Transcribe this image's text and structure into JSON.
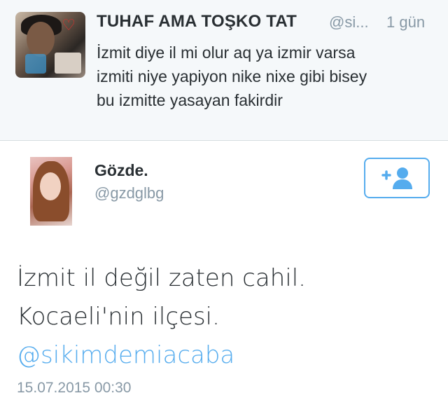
{
  "top_tweet": {
    "name": "TUHAF AMA TOŞKO TAT",
    "handle": "@si...",
    "time": "1 gün",
    "lines": [
      "İzmit diye il mi olur aq ya izmir varsa",
      "izmiti niye yapiyon nike nixe gibi bisey",
      "bu izmitte yasayan fakirdir"
    ]
  },
  "main_tweet": {
    "name": "Gözde.",
    "handle": "@gzdglbg",
    "lines": [
      "İzmit il değil zaten cahil.",
      "Kocaeli'nin ilçesi."
    ],
    "mention": "@sikimdemiacaba",
    "date": "15.07.2015 00:30"
  },
  "follow_button": {
    "icon": "add-user-icon"
  },
  "colors": {
    "accent": "#55acee",
    "secondary_text": "#8899a6",
    "primary_text": "#292f33"
  }
}
